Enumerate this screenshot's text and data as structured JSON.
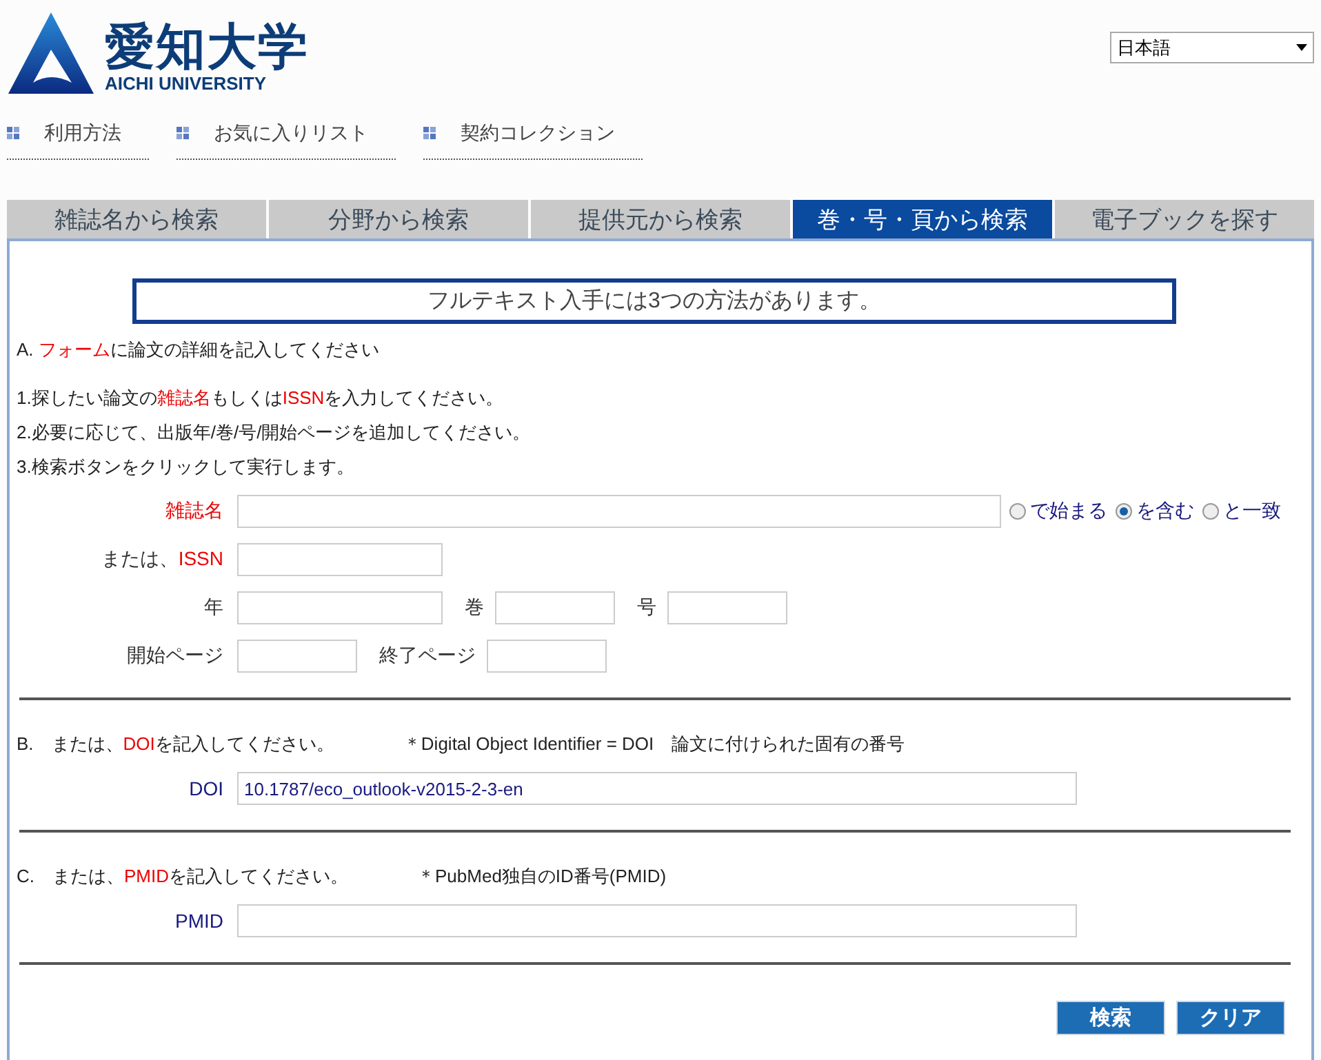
{
  "header": {
    "logo_title": "愛知大学",
    "logo_subtitle": "AICHI UNIVERSITY",
    "language_select": {
      "value": "日本語"
    }
  },
  "nav": [
    {
      "label": "利用方法"
    },
    {
      "label": "お気に入りリスト"
    },
    {
      "label": "契約コレクション"
    }
  ],
  "tabs": [
    {
      "label": "雑誌名から検索",
      "selected": false
    },
    {
      "label": "分野から検索",
      "selected": false
    },
    {
      "label": "提供元から検索",
      "selected": false
    },
    {
      "label": "巻・号・頁から検索",
      "selected": true
    },
    {
      "label": "電子ブックを探す",
      "selected": false
    }
  ],
  "notice": "フルテキスト入手には3つの方法があります。",
  "section_a": {
    "heading": [
      {
        "text": "A. "
      },
      {
        "text": "フォーム",
        "highlight": true
      },
      {
        "text": "に論文の詳細を記入してください"
      }
    ],
    "steps": [
      [
        {
          "text": "1.探したい論文の"
        },
        {
          "text": "雑誌名",
          "highlight": true
        },
        {
          "text": "もしくは"
        },
        {
          "text": "ISSN",
          "highlight": true
        },
        {
          "text": "を入力してください。"
        }
      ],
      [
        {
          "text": "2.必要に応じて、出版年/巻/号/開始ページを追加してください。"
        }
      ],
      [
        {
          "text": "3.検索ボタンをクリックして実行します。"
        }
      ]
    ],
    "rows": [
      {
        "label": [
          {
            "text": "雑誌名",
            "highlight": true
          }
        ],
        "radios": [
          {
            "label": "で始まる",
            "selected": false
          },
          {
            "label": "を含む",
            "selected": true
          },
          {
            "label": "と一致",
            "selected": false
          }
        ]
      },
      {
        "label": [
          {
            "text": "または、"
          },
          {
            "text": "ISSN",
            "highlight": true
          }
        ]
      },
      {
        "label": [
          {
            "text": "年"
          }
        ],
        "more": [
          {
            "label": "巻"
          },
          {
            "label": "号"
          }
        ]
      },
      {
        "label": [
          {
            "text": "開始ページ"
          }
        ],
        "more": [
          {
            "label": "終了ページ"
          }
        ]
      }
    ]
  },
  "section_b": {
    "heading": [
      {
        "text": "B.　または、"
      },
      {
        "text": "DOI",
        "highlight": true
      },
      {
        "text": "を記入してください。"
      }
    ],
    "note": "＊Digital Object Identifier = DOI　論文に付けられた固有の番号",
    "field_label": "DOI",
    "value": "10.1787/eco_outlook-v2015-2-3-en"
  },
  "section_c": {
    "heading": [
      {
        "text": "C.　または、"
      },
      {
        "text": "PMID",
        "highlight": true
      },
      {
        "text": "を記入してください。"
      }
    ],
    "note": "＊PubMed独自のID番号(PMID)",
    "field_label": "PMID"
  },
  "buttons": [
    {
      "label": "検索"
    },
    {
      "label": "クリア"
    }
  ]
}
